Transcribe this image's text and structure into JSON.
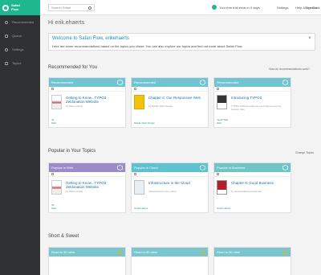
{
  "app": {
    "logo_line1": "Safari",
    "logo_line2": "Flow"
  },
  "sidebar": {
    "items": [
      {
        "label": "Recommended",
        "icon": "star-icon"
      },
      {
        "label": "Queue",
        "icon": "list-icon"
      },
      {
        "label": "Settings",
        "icon": "gear-icon"
      },
      {
        "label": "Topics",
        "icon": "tag-icon"
      }
    ]
  },
  "header": {
    "search_placeholder": "Search Safari",
    "trial_text": "Your free trial ends in 9 days.",
    "links": [
      "Settings",
      "Help & Feedback",
      "Sign Out"
    ]
  },
  "greeting": "Hi erik.ehaerts",
  "welcome": {
    "title": "Welcome to Safari Flow, erikehaerts",
    "message": "Here are some recommendations based on the topics you chose. You can also explore our topics and find out more about Safari Flow."
  },
  "sections": {
    "recommended": {
      "title": "Recommended for You",
      "link": "How do recommendations work?"
    },
    "popular": {
      "title": "Popular in Your Topics",
      "link": "Change Topics"
    },
    "short": {
      "title": "Short & Sweet"
    }
  },
  "cards_recommended": [
    {
      "header": "Recommended",
      "title": "Getting to Know...TYPO3 Zeldonation Website",
      "meta": "by Marco Hrbek",
      "foot_small": "45",
      "foot": "Web"
    },
    {
      "header": "Recommended",
      "title": "Chapter 6: Our Responsive Web",
      "meta": "by Mobile Web Design",
      "foot_small": "",
      "foot": "Mobile Web Design"
    },
    {
      "header": "Recommended",
      "title": "Introducing TYPO3",
      "meta": "TYPO3 CMS Development and Deployment by Gordon Klee",
      "foot_small": "CHAPTER",
      "foot": "Web"
    }
  ],
  "cards_popular": [
    {
      "header": "Popular in Web",
      "title": "Getting to Know...TYPO3 Zeldonation Website",
      "meta": "by Marco Hrbek",
      "foot_small": "45",
      "foot": "Web"
    },
    {
      "header": "Popular in Cloud",
      "title": "Infrastructure in the Cloud",
      "meta": "Infrastructure in the Cloud",
      "foot_small": "",
      "foot": "Small Harbor"
    },
    {
      "header": "Popular in Business",
      "title": "Chapter 8: Good Business",
      "meta": "by Harvard Business Review",
      "foot_small": "",
      "foot": "Small Harbor"
    }
  ],
  "cards_short": [
    {
      "header": "Read in 30 mins"
    },
    {
      "header": "Read in 30 mins"
    },
    {
      "header": "Read in 30 mins"
    }
  ],
  "colors": {
    "accent": "#1fb88e",
    "sidebar": "#2f3133",
    "link": "#1d8fb5",
    "head_rec": "#71c5d3",
    "head_web": "#9a8bc9",
    "head_cloud": "#5ec1d0",
    "head_biz": "#6fc4c7",
    "head_short": "#7ac5cf"
  }
}
